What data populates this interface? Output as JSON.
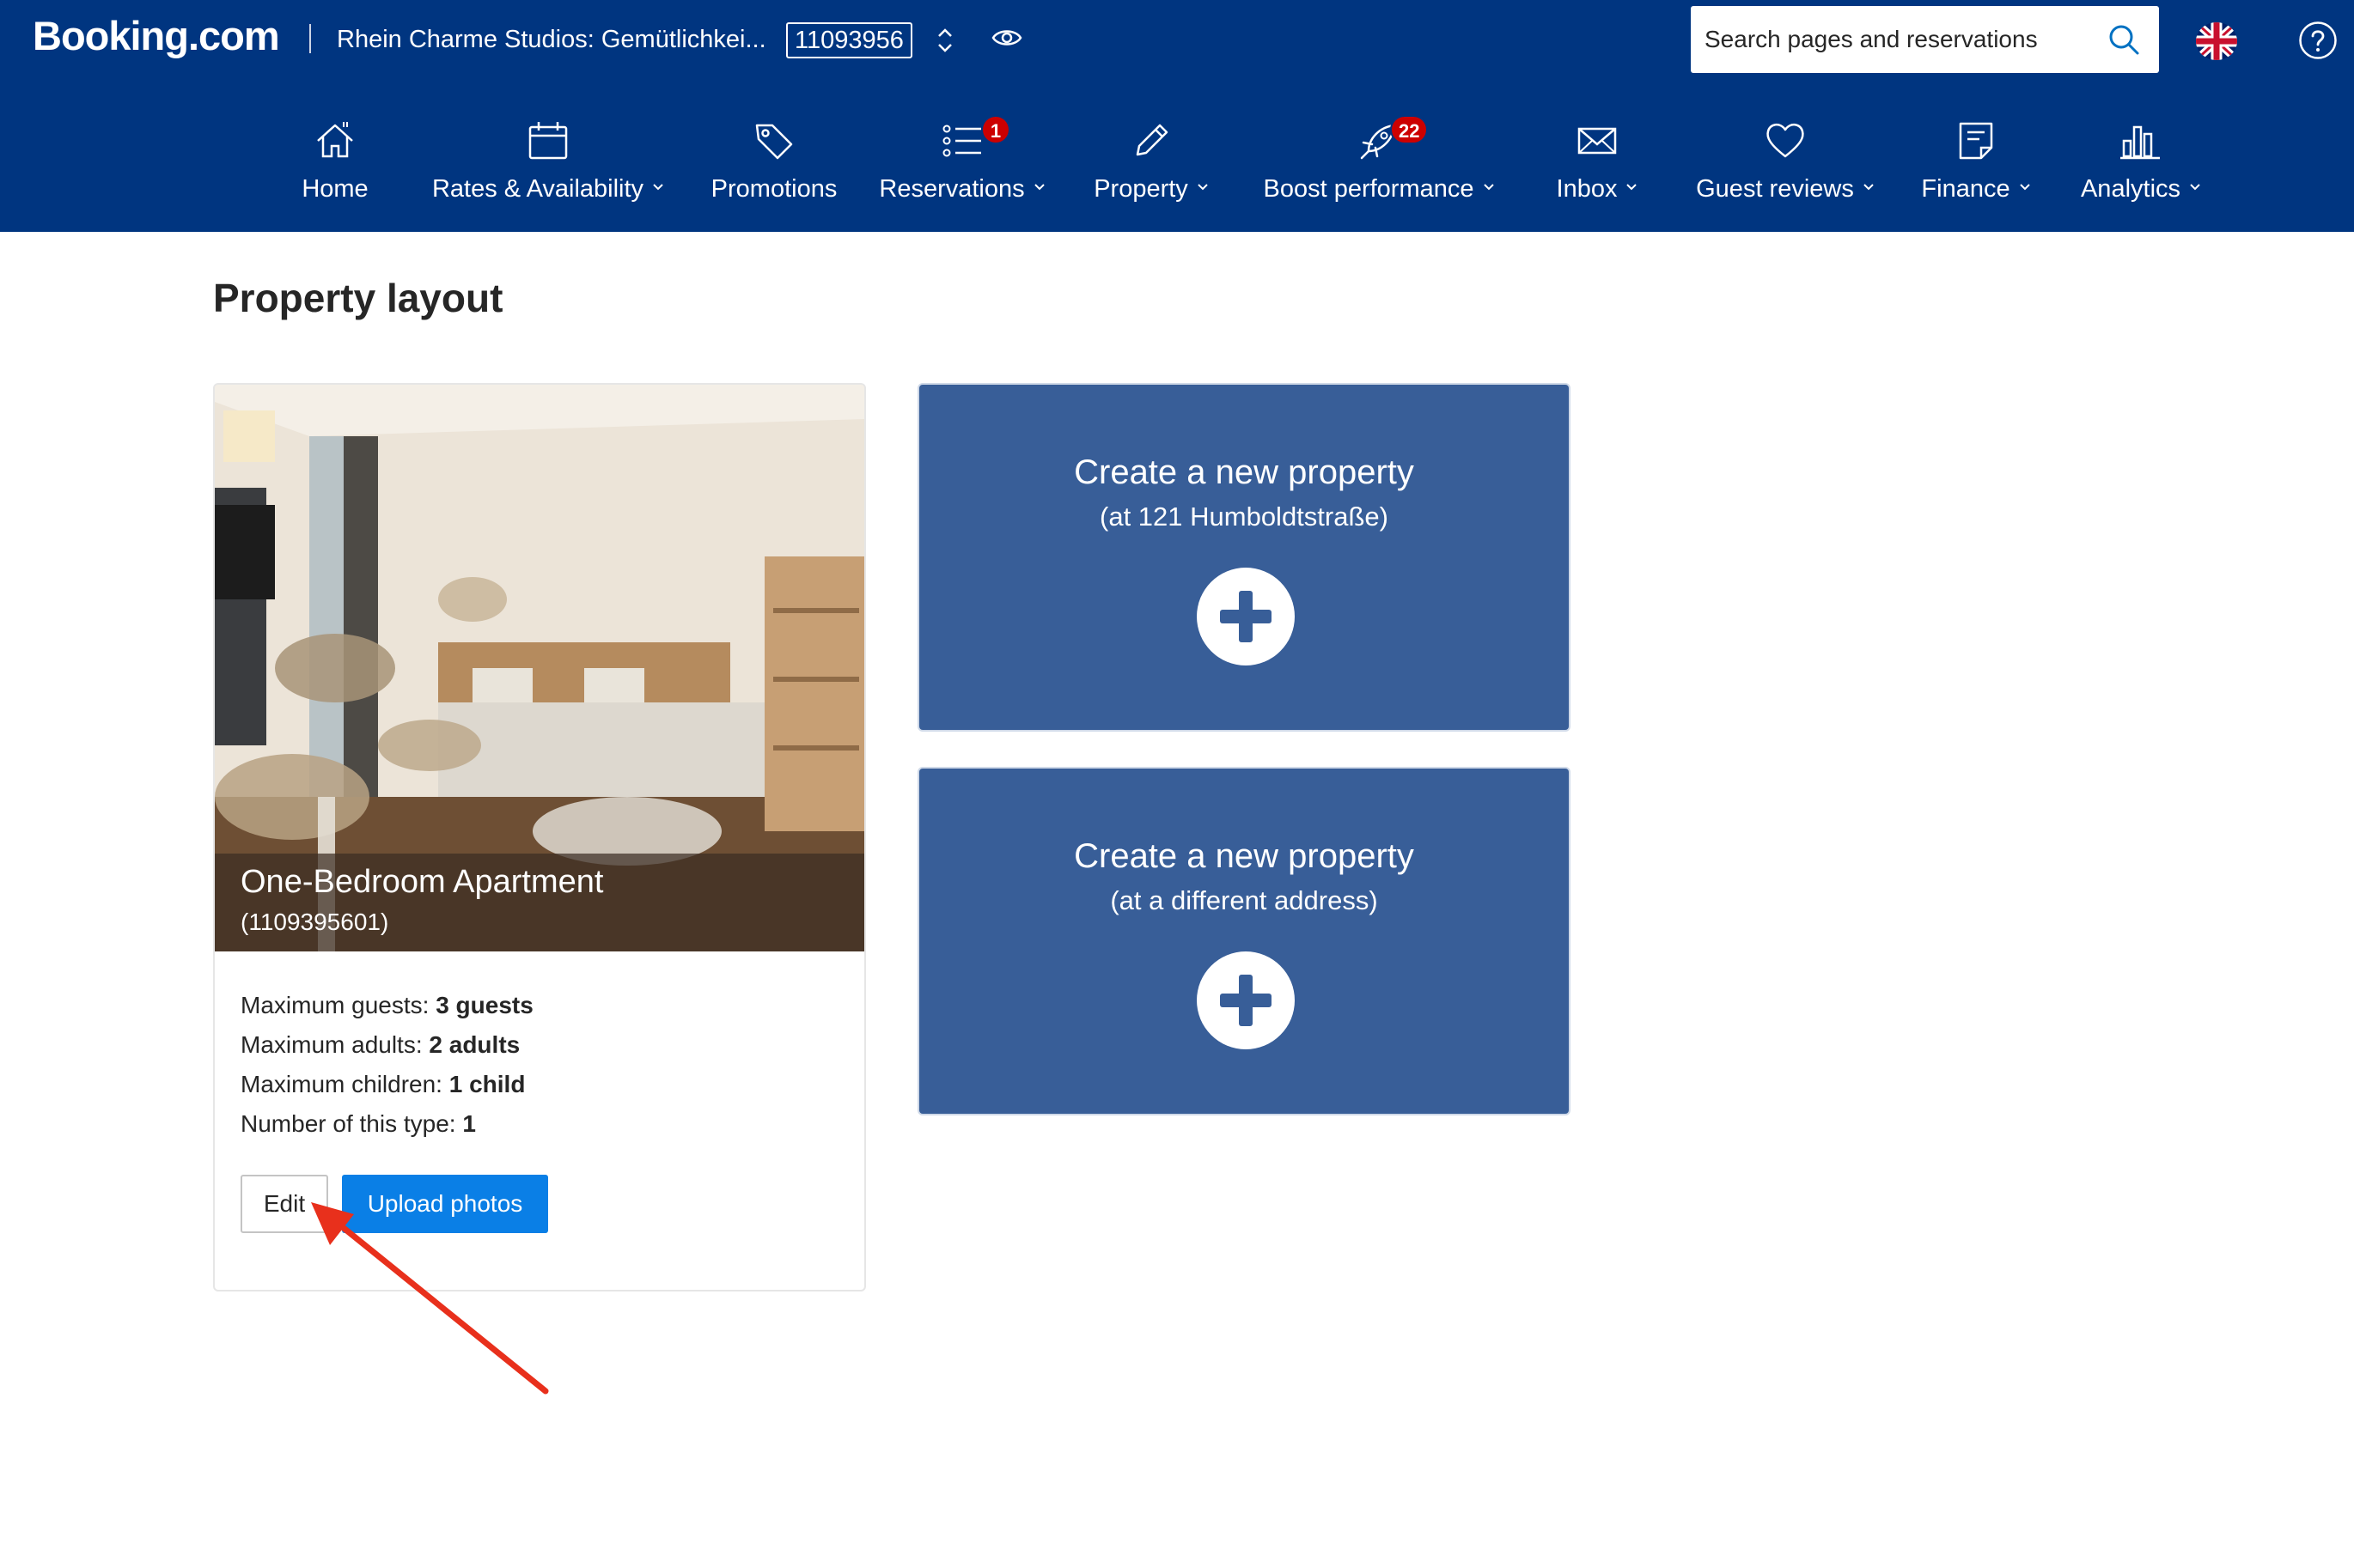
{
  "header": {
    "logo": "Booking.com",
    "property_name": "Rhein Charme Studios: Gemütlichkei...",
    "property_id": "11093956",
    "search": {
      "placeholder": "Search pages and reservations"
    }
  },
  "nav": {
    "items": [
      {
        "label": "Home",
        "icon": "home-icon"
      },
      {
        "label": "Rates & Availability",
        "icon": "calendar-icon"
      },
      {
        "label": "Promotions",
        "icon": "tag-icon"
      },
      {
        "label": "Reservations",
        "icon": "list-icon",
        "badge": "1"
      },
      {
        "label": "Property",
        "icon": "pencil-icon"
      },
      {
        "label": "Boost performance",
        "icon": "rocket-icon",
        "badge": "22"
      },
      {
        "label": "Inbox",
        "icon": "envelope-icon"
      },
      {
        "label": "Guest reviews",
        "icon": "heart-icon"
      },
      {
        "label": "Finance",
        "icon": "document-icon"
      },
      {
        "label": "Analytics",
        "icon": "bar-chart-icon"
      }
    ]
  },
  "page": {
    "title": "Property layout"
  },
  "unit": {
    "title": "One-Bedroom Apartment",
    "id": "(1109395601)",
    "specs": [
      {
        "label": "Maximum guests:",
        "value": "3 guests"
      },
      {
        "label": "Maximum adults:",
        "value": "2 adults"
      },
      {
        "label": "Maximum children:",
        "value": "1 child"
      },
      {
        "label": "Number of this type:",
        "value": "1"
      }
    ],
    "edit_label": "Edit",
    "upload_label": "Upload photos"
  },
  "create_cards": [
    {
      "title": "Create a new property",
      "subtitle": "(at 121 Humboldtstraße)"
    },
    {
      "title": "Create a new property",
      "subtitle": "(at a different address)"
    }
  ],
  "colors": {
    "header_bg": "#003580",
    "card_blue": "#385e98",
    "button_blue": "#0a7fe6",
    "badge_red": "#cc0000",
    "arrow_red": "#e8301c"
  }
}
